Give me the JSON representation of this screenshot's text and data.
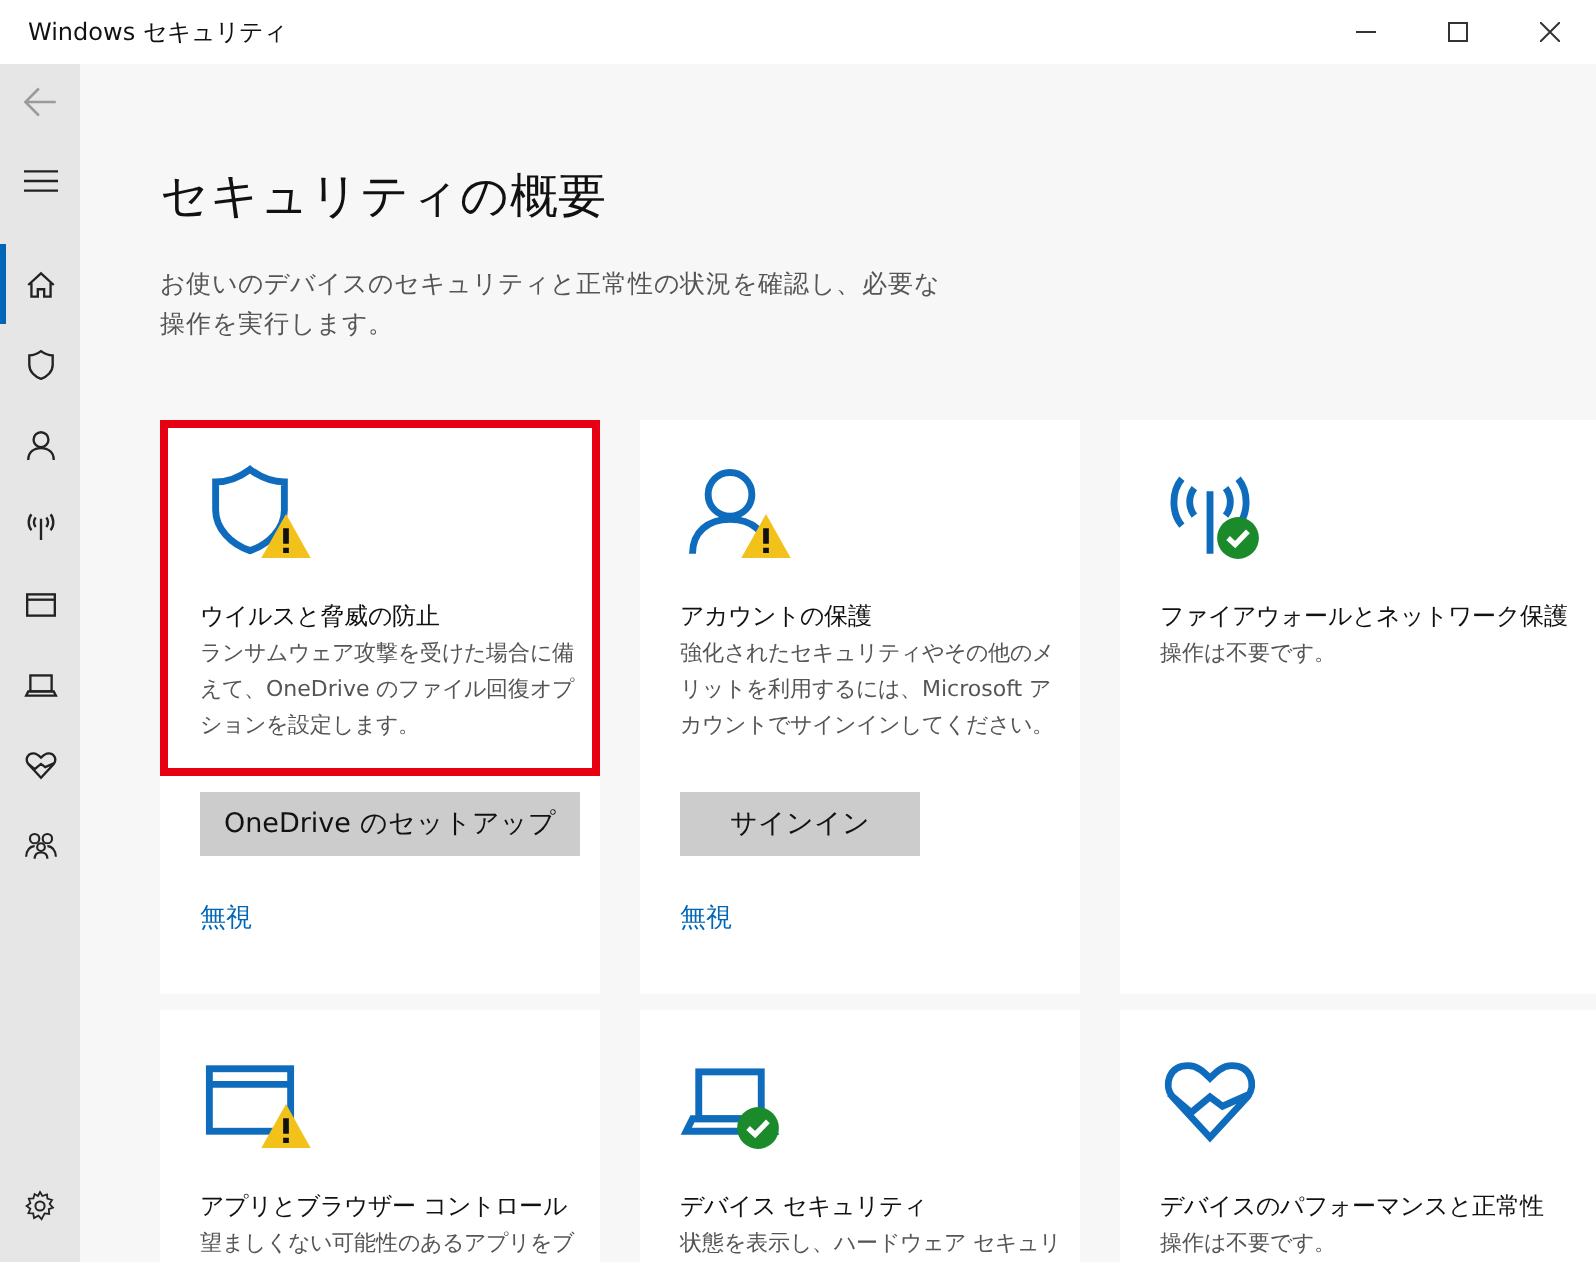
{
  "window": {
    "title": "Windows セキュリティ"
  },
  "sidebar": {
    "items": [
      {
        "selected": true
      },
      {
        "selected": false
      },
      {
        "selected": false
      },
      {
        "selected": false
      },
      {
        "selected": false
      },
      {
        "selected": false
      },
      {
        "selected": false
      },
      {
        "selected": false
      }
    ]
  },
  "heading": "セキュリティの概要",
  "description": "お使いのデバイスのセキュリティと正常性の状況を確認し、必要な操作を実行します。",
  "cards": [
    {
      "warning": true,
      "ok": false,
      "highlighted": true,
      "title": "ウイルスと脅威の防止",
      "text": "ランサムウェア攻撃を受けた場合に備えて、OneDrive のファイル回復オプションを設定します。",
      "button": "OneDrive のセットアップ",
      "link": "無視"
    },
    {
      "warning": true,
      "ok": false,
      "highlighted": false,
      "title": "アカウントの保護",
      "text": "強化されたセキュリティやその他のメリットを利用するには、Microsoft アカウントでサインインしてください。",
      "button": "サインイン",
      "link": "無視"
    },
    {
      "warning": false,
      "ok": true,
      "highlighted": false,
      "title": "ファイアウォールとネットワーク保護",
      "text": "操作は不要です。"
    },
    {
      "warning": true,
      "ok": false,
      "highlighted": false,
      "title": "アプリとブラウザー コントロール",
      "text": "望ましくない可能性のあるアプリをブ"
    },
    {
      "warning": false,
      "ok": true,
      "highlighted": false,
      "title": "デバイス セキュリティ",
      "text": "状態を表示し、ハードウェア セキュリ"
    },
    {
      "warning": false,
      "ok": false,
      "highlighted": false,
      "title": "デバイスのパフォーマンスと正常性",
      "text": "操作は不要です。"
    }
  ]
}
